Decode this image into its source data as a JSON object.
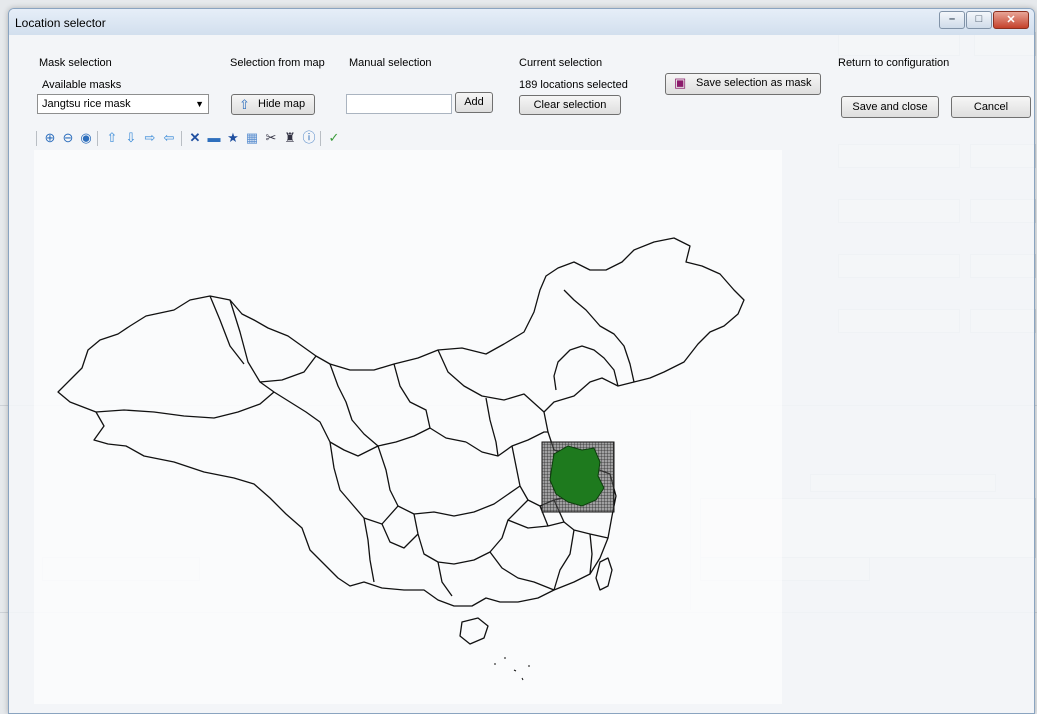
{
  "window": {
    "title": "Location selector"
  },
  "mask_selection": {
    "group_label": "Mask selection",
    "available_label": "Available masks",
    "selected_mask": "Jangtsu rice mask"
  },
  "selection_from_map": {
    "group_label": "Selection from map",
    "hide_map_label": "Hide map"
  },
  "manual_selection": {
    "group_label": "Manual selection",
    "input_value": "",
    "add_label": "Add"
  },
  "current_selection": {
    "group_label": "Current selection",
    "count_text": "189 locations selected",
    "clear_label": "Clear selection"
  },
  "save_mask": {
    "label": "Save selection as mask"
  },
  "return_config": {
    "group_label": "Return to configuration",
    "save_close_label": "Save and close",
    "cancel_label": "Cancel"
  },
  "toolbar": {
    "icons": [
      "zoom-in-icon",
      "zoom-out-icon",
      "zoom-extent-icon",
      "pan-up-icon",
      "pan-down-icon",
      "pan-right-icon",
      "pan-left-icon",
      "delete-icon",
      "select-rectangle-icon",
      "favorite-icon",
      "table-icon",
      "cut-icon",
      "identify-icon",
      "info-icon",
      "confirm-icon"
    ]
  },
  "colors": {
    "selection_fill": "#1e7a1e",
    "grid": "#2a2a2a",
    "accent": "#2e6fbd"
  }
}
